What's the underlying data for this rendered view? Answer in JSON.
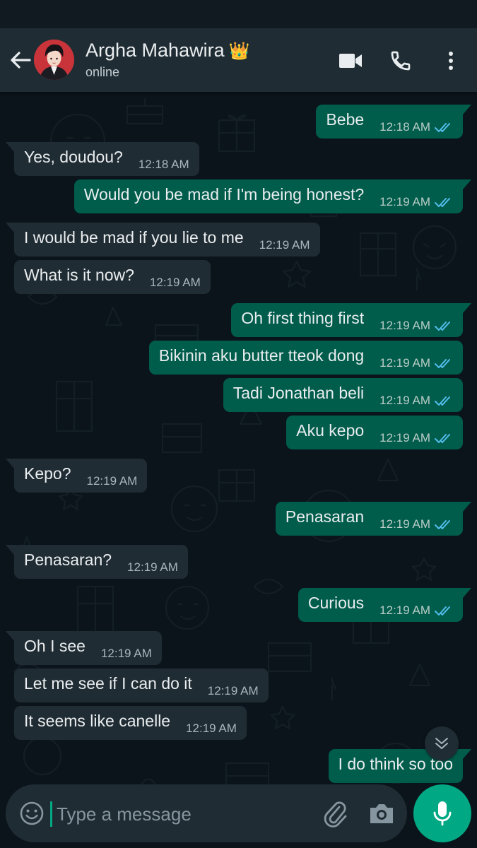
{
  "header": {
    "contact_name": "Argha Mahawira",
    "crown": "👑",
    "status": "online"
  },
  "messages": [
    {
      "dir": "out",
      "text": "Bebe",
      "time": "12:18 AM",
      "tail": true,
      "gap": false
    },
    {
      "dir": "in",
      "text": "Yes, doudou?",
      "time": "12:18 AM",
      "tail": true,
      "gap": false
    },
    {
      "dir": "out",
      "text": "Would you be mad if I'm being honest?",
      "time": "12:19 AM",
      "tail": true,
      "gap": true
    },
    {
      "dir": "in",
      "text": "I would be mad if you lie to me",
      "time": "12:19 AM",
      "tail": true,
      "gap": false
    },
    {
      "dir": "in",
      "text": "What is it now?",
      "time": "12:19 AM",
      "tail": false,
      "gap": true
    },
    {
      "dir": "out",
      "text": "Oh first thing first",
      "time": "12:19 AM",
      "tail": true,
      "gap": false
    },
    {
      "dir": "out",
      "text": "Bikinin aku butter tteok dong",
      "time": "12:19 AM",
      "tail": false,
      "gap": false
    },
    {
      "dir": "out",
      "text": "Tadi Jonathan beli",
      "time": "12:19 AM",
      "tail": false,
      "gap": false
    },
    {
      "dir": "out",
      "text": "Aku kepo",
      "time": "12:19 AM",
      "tail": false,
      "gap": true
    },
    {
      "dir": "in",
      "text": "Kepo?",
      "time": "12:19 AM",
      "tail": true,
      "gap": true
    },
    {
      "dir": "out",
      "text": "Penasaran",
      "time": "12:19 AM",
      "tail": true,
      "gap": true
    },
    {
      "dir": "in",
      "text": "Penasaran?",
      "time": "12:19 AM",
      "tail": true,
      "gap": true
    },
    {
      "dir": "out",
      "text": "Curious",
      "time": "12:19 AM",
      "tail": true,
      "gap": true
    },
    {
      "dir": "in",
      "text": "Oh I see",
      "time": "12:19 AM",
      "tail": true,
      "gap": false
    },
    {
      "dir": "in",
      "text": "Let me see if I can do it",
      "time": "12:19 AM",
      "tail": false,
      "gap": false
    },
    {
      "dir": "in",
      "text": "It seems like canelle",
      "time": "12:19 AM",
      "tail": false,
      "gap": true
    },
    {
      "dir": "out",
      "text": "I do think so too",
      "time": "",
      "tail": true,
      "gap": false
    }
  ],
  "composer": {
    "placeholder": "Type a message"
  },
  "colors": {
    "header_bg": "#1f2c33",
    "chat_bg": "#0b141a",
    "incoming_bubble": "#202c33",
    "outgoing_bubble": "#005c4b",
    "accent": "#00a884",
    "read_ticks": "#53bdeb"
  },
  "icons": [
    "back-arrow-icon",
    "video-call-icon",
    "voice-call-icon",
    "more-options-icon",
    "double-check-icon",
    "scroll-down-icon",
    "emoji-icon",
    "attach-icon",
    "camera-icon",
    "mic-icon"
  ]
}
